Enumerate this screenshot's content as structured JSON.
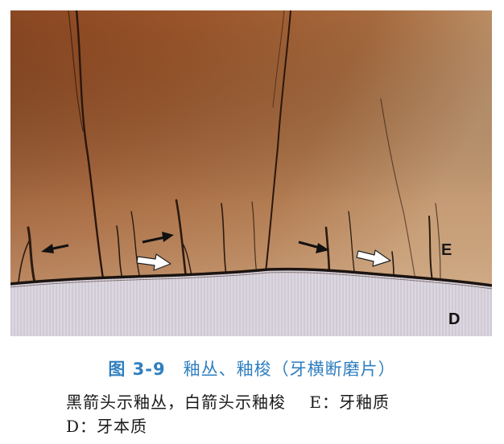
{
  "figure": {
    "label_enamel": "E",
    "label_dentin": "D",
    "colors": {
      "enamel_dark": "#7a3f1c",
      "enamel_mid": "#9e5a2e",
      "enamel_light": "#c79a70",
      "dentin": "#d8d2dc",
      "border": "#1c1410"
    },
    "arrows": [
      {
        "type": "black-arrow",
        "meaning": "enamel tufts"
      },
      {
        "type": "black-arrow",
        "meaning": "enamel tufts"
      },
      {
        "type": "black-arrow",
        "meaning": "enamel tufts"
      },
      {
        "type": "white-arrow",
        "meaning": "enamel spindles"
      },
      {
        "type": "white-arrow",
        "meaning": "enamel spindles"
      }
    ]
  },
  "caption": {
    "figure_number": "图 3-9",
    "title": "釉丛、釉梭（牙横断磨片）"
  },
  "notes": {
    "line1": "黑箭头示釉丛，白箭头示釉梭    E：牙釉质",
    "line2": "D：牙本质"
  }
}
